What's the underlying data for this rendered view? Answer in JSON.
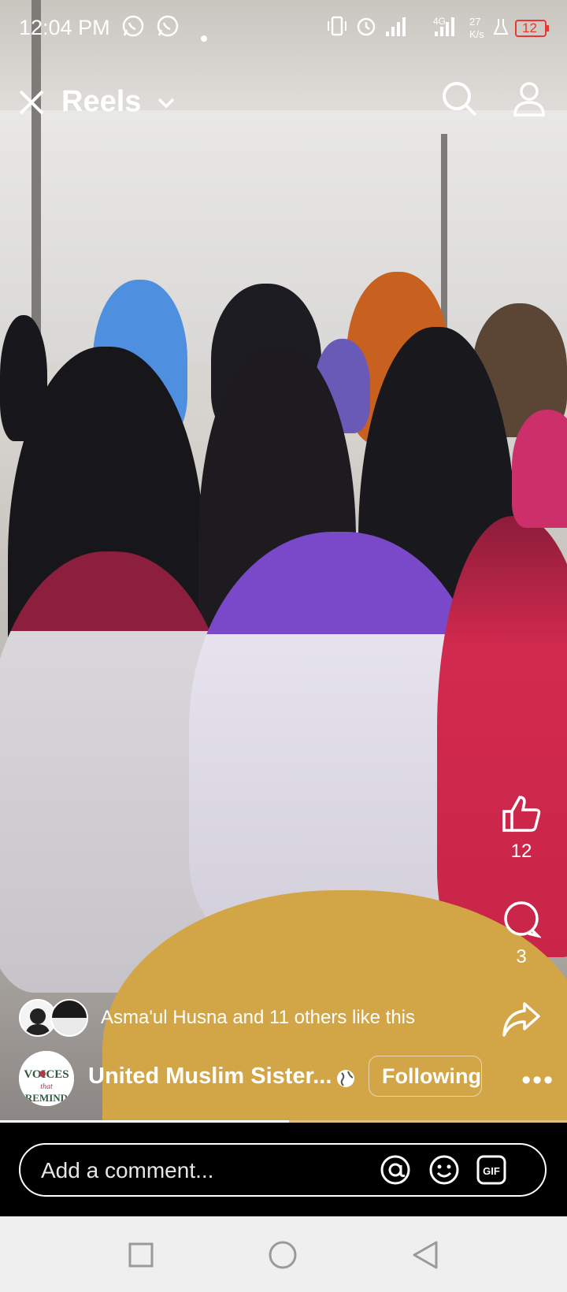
{
  "status_bar": {
    "time": "12:04 PM",
    "network_label": "4G",
    "speed_value": "27",
    "speed_unit": "K/s",
    "battery": "12"
  },
  "header": {
    "title": "Reels"
  },
  "actions": {
    "like_count": "12",
    "comment_count": "3"
  },
  "social": {
    "likes_text": "Asma'ul Husna and 11 others like this"
  },
  "page": {
    "name": "United Muslim Sister...",
    "avatar_text": "VOICES that REMIND",
    "follow_label": "Following",
    "more_label": "•••"
  },
  "video": {
    "progress": 0.51
  },
  "comment": {
    "placeholder": "Add a comment..."
  },
  "colors": {
    "accent": "#ffffff",
    "battery_low": "#e53935"
  }
}
